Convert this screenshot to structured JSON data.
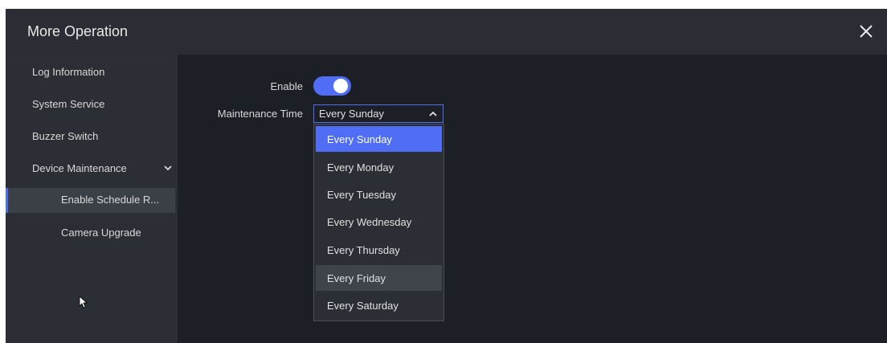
{
  "window": {
    "title": "More Operation",
    "close_icon": "close-icon"
  },
  "sidebar": {
    "items": [
      {
        "label": "Log Information"
      },
      {
        "label": "System Service"
      },
      {
        "label": "Buzzer Switch"
      },
      {
        "label": "Device Maintenance",
        "expanded": true
      },
      {
        "label": "Enable Schedule R...",
        "active": true
      },
      {
        "label": "Camera Upgrade"
      }
    ]
  },
  "form": {
    "enable_label": "Enable",
    "enable_value": true,
    "maintenance_label": "Maintenance Time",
    "maintenance_value": "Every Sunday"
  },
  "dropdown": {
    "options": [
      "Every Sunday",
      "Every Monday",
      "Every Tuesday",
      "Every Wednesday",
      "Every Thursday",
      "Every Friday",
      "Every Saturday"
    ],
    "selected": "Every Sunday",
    "hovered": "Every Friday"
  },
  "colors": {
    "accent": "#4f6df5",
    "background": "#1c1f25",
    "sidebar": "#2b2e34",
    "titlebar": "#2a2d33"
  }
}
